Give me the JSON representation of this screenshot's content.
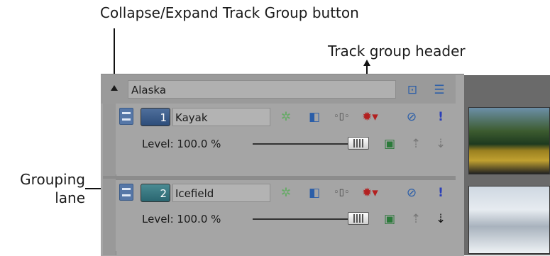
{
  "callouts": {
    "collapse": "Collapse/Expand Track Group button",
    "header": "Track group header",
    "grouping_line1": "Grouping",
    "grouping_line2": "lane"
  },
  "group": {
    "name": "Alaska"
  },
  "tracks": [
    {
      "number": "1",
      "name": "Kayak",
      "level": "Level: 100.0 %",
      "color": "#3a5f8e"
    },
    {
      "number": "2",
      "name": "Icefield",
      "level": "Level: 100.0 %",
      "color": "#3a7b86"
    }
  ],
  "icons": {
    "group_header": [
      "track-header-icon",
      "group-menu-icon"
    ],
    "track_row": [
      "fx-icon",
      "compositing-mode-icon",
      "pan-crop-icon",
      "gear-icon",
      "mute-icon",
      "solo-icon"
    ],
    "level_row": [
      "overlay-icon",
      "parent-track-icon",
      "child-track-icon"
    ]
  },
  "level_slider_fraction": 1.0
}
